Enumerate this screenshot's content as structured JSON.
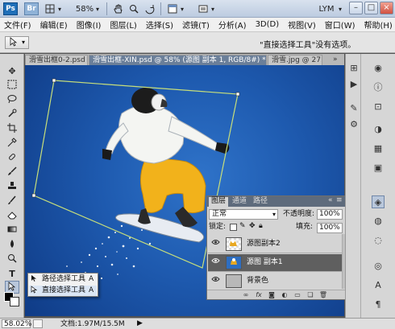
{
  "topbar": {
    "ps_logo": "Ps",
    "br_logo": "Br",
    "zoom": "58%",
    "zoom_arrow": "▾",
    "workspace": "LYM",
    "workspace_arrow": "▾",
    "win_min": "–",
    "win_max": "□",
    "win_close": "×"
  },
  "menu": {
    "items": [
      "文件(F)",
      "编辑(E)",
      "图像(I)",
      "图层(L)",
      "选择(S)",
      "滤镜(T)",
      "分析(A)",
      "3D(D)",
      "视图(V)",
      "窗口(W)",
      "帮助(H)"
    ]
  },
  "options": {
    "hint": "\"直接选择工具\"没有选项。"
  },
  "tabs": [
    {
      "label": "滑雪出框0-2.psd",
      "active": false
    },
    {
      "label": "滑雪出框-XIN.psd @ 58% (源图 副本 1, RGB/8#) *",
      "active": true
    },
    {
      "label": "滑雪.jpg @ 27...",
      "active": false
    }
  ],
  "tab_close": "×",
  "status": {
    "zoom": "58.02%",
    "doc": "文档:1.97M/15.5M"
  },
  "layers": {
    "tabs": [
      "图层",
      "通道",
      "路径"
    ],
    "blend_mode": "正常",
    "opacity_label": "不透明度:",
    "opacity_value": "100%",
    "lock_label": "锁定:",
    "fill_label": "填充:",
    "fill_value": "100%",
    "items": [
      {
        "name": "源图副本2",
        "selected": false
      },
      {
        "name": "源图 副本1",
        "selected": true
      },
      {
        "name": "背景色",
        "selected": false
      }
    ]
  },
  "flyout": {
    "items": [
      {
        "label": "路径选择工具",
        "key": "A"
      },
      {
        "label": "直接选择工具",
        "key": "A"
      }
    ]
  },
  "icons": {
    "hand": "hand-icon",
    "zoom": "zoom-icon",
    "rotate": "rotate-icon",
    "eye": "eye-icon",
    "fx": "fx-icon",
    "trash": "trash-icon"
  },
  "colors": {
    "accent": "#1f6fb8",
    "active_tab": "#6b7f99",
    "selected_layer": "#5f5f5f",
    "path_stroke": "#c8df7a"
  }
}
